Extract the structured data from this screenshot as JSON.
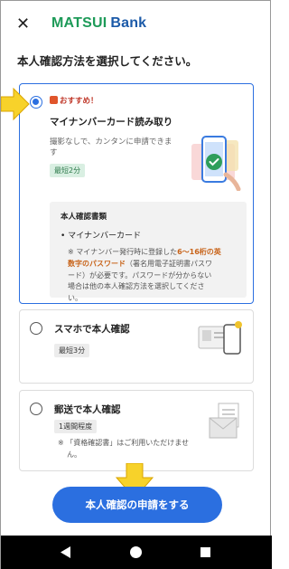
{
  "header": {
    "close_glyph": "✕",
    "logo_part1": "MATSUI",
    "logo_part2": "Bank"
  },
  "prompt": "本人確認方法を選択してください。",
  "options": [
    {
      "recommend": "おすすめ！",
      "title": "マイナンバーカード読み取り",
      "desc_line1": "撮影なしで、カンタンに申請できま",
      "desc_line2": "す",
      "time": "最短2分",
      "selected": true,
      "doc_heading": "本人確認書類",
      "doc_item": "マイナンバーカード",
      "note_line1": "マイナンバー発行時に登録した",
      "note_hl1": "6〜16桁の英",
      "note_hl2": "数字のパスワード",
      "note_rest2": "（署名用電子証明書パスワ",
      "note_line3": "ード）が必要です。パスワードが分からない",
      "note_line4": "場合は他の本人確認方法を選択してくださ",
      "note_line5": "い。"
    },
    {
      "title": "スマホで本人確認",
      "time": "最短3分",
      "selected": false
    },
    {
      "title": "郵送で本人確認",
      "time": "1週間程度",
      "note_line1": "「資格確認書」はご利用いただけませ",
      "note_line2": "ん。",
      "selected": false
    }
  ],
  "cta_label": "本人確認の申請をする",
  "colors": {
    "primary": "#2b6fe0",
    "logo_green": "#1d9a58",
    "logo_blue": "#1b5aa8",
    "highlight": "#c8641a",
    "arrow_yellow": "#f7d22a"
  }
}
